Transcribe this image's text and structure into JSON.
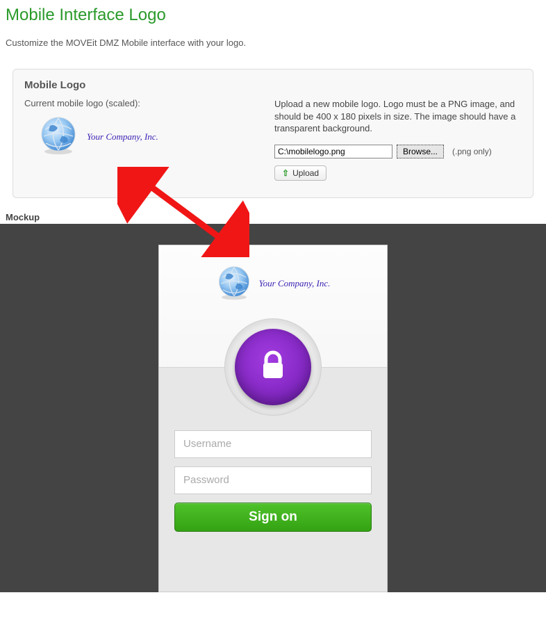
{
  "page": {
    "title": "Mobile Interface Logo",
    "description": "Customize the MOVEit DMZ Mobile interface with your logo."
  },
  "panel": {
    "title": "Mobile Logo",
    "current_label": "Current mobile logo (scaled):",
    "company_text": "Your Company, Inc.",
    "upload_desc": "Upload a new mobile logo. Logo must be a PNG image, and should be 400 x 180 pixels in size. The image should have a transparent background.",
    "file_path_value": "C:\\mobilelogo.png",
    "browse_label": "Browse...",
    "png_only": "(.png only)",
    "upload_label": "Upload"
  },
  "mockup": {
    "label": "Mockup",
    "company_text": "Your Company, Inc.",
    "username_placeholder": "Username",
    "password_placeholder": "Password",
    "sign_on_label": "Sign on"
  },
  "colors": {
    "title_green": "#2a9a2a",
    "lock_purple": "#7f24c2",
    "button_green": "#3fb21f",
    "arrow_red": "#f01616"
  }
}
